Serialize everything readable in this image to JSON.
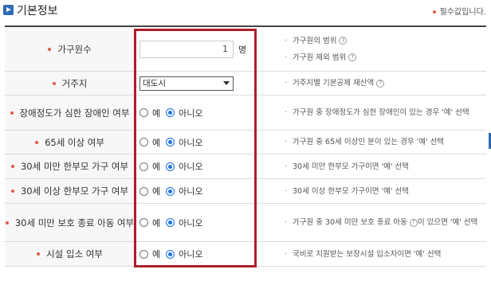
{
  "header": {
    "title": "기본정보",
    "required_note": "필수값입니다."
  },
  "rows": [
    {
      "label": "가구원수",
      "type": "number",
      "value": "1",
      "unit": "명",
      "desc": [
        "가구원의 범위",
        "가구원 제외 범위"
      ],
      "desc_help": [
        true,
        true
      ]
    },
    {
      "label": "거주지",
      "type": "select",
      "selected": "대도시",
      "desc": [
        "거주지별 기본공제 재산액"
      ],
      "desc_help": [
        true
      ]
    },
    {
      "label": "장애정도가 심한 장애인 여부",
      "type": "radio",
      "options": [
        "예",
        "아니오"
      ],
      "selected_index": 1,
      "desc": [
        "가구원 중 장애정도가 심한 장애인이 있는 경우 '예' 선택"
      ]
    },
    {
      "label": "65세 이상 여부",
      "type": "radio",
      "options": [
        "예",
        "아니오"
      ],
      "selected_index": 1,
      "desc": [
        "가구원 중 65세 이상인 분이 있는 경우 '예' 선택"
      ]
    },
    {
      "label": "30세 미만 한부모 가구 여부",
      "type": "radio",
      "options": [
        "예",
        "아니오"
      ],
      "selected_index": 1,
      "desc": [
        "30세 미만 한부모 가구이면 '예' 선택"
      ]
    },
    {
      "label": "30세 이상 한부모 가구 여부",
      "type": "radio",
      "options": [
        "예",
        "아니오"
      ],
      "selected_index": 1,
      "desc": [
        "30세 이상 한부모 가구이면 '예' 선택"
      ]
    },
    {
      "label": "30세 미만 보호 종료 아동 여부",
      "type": "radio",
      "options": [
        "예",
        "아니오"
      ],
      "selected_index": 1,
      "desc": [
        "가구원 중 30세 미만 보호 종료 아동",
        "이 있으면 '예' 선택"
      ],
      "desc_help_inline": true
    },
    {
      "label": "시설 입소 여부",
      "type": "radio",
      "options": [
        "예",
        "아니오"
      ],
      "selected_index": 1,
      "desc": [
        "국비로 지원받는 보장시설 입소자이면 '예' 선택"
      ]
    }
  ],
  "colors": {
    "accent": "#2d6db5",
    "required_dot": "#e05a4a",
    "highlight_border": "#b11c2b",
    "radio_selected": "#1a73e8"
  }
}
